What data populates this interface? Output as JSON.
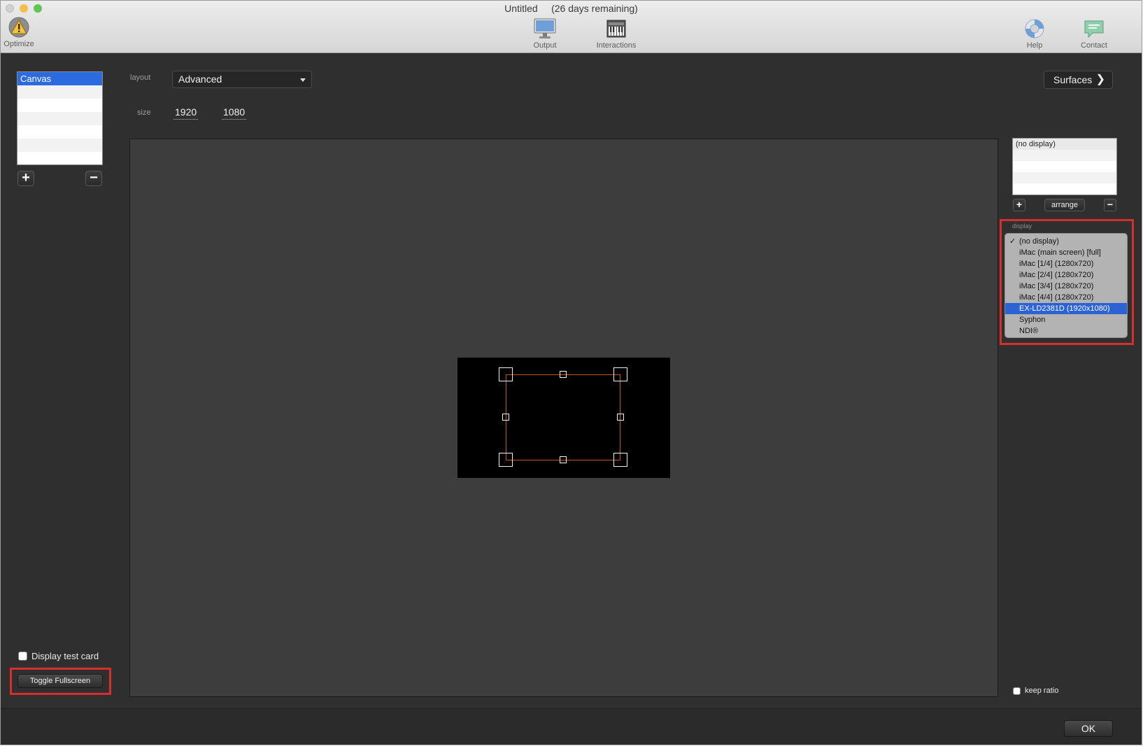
{
  "window": {
    "title": "Untitled",
    "subtitle": "(26 days remaining)"
  },
  "toolbar": {
    "optimize_label": "Optimize",
    "output_label": "Output",
    "interactions_label": "Interactions",
    "help_label": "Help",
    "contact_label": "Contact"
  },
  "canvas_list": {
    "items": [
      "Canvas"
    ]
  },
  "layout": {
    "label": "layout",
    "value": "Advanced"
  },
  "size": {
    "label": "size",
    "width": "1920",
    "height": "1080"
  },
  "surfaces_label": "Surfaces",
  "display_list": {
    "items": [
      "(no display)"
    ]
  },
  "arrange_label": "arrange",
  "display_menu": {
    "label": "display",
    "items": [
      "(no display)",
      "iMac (main screen) [full]",
      "iMac [1/4] (1280x720)",
      "iMac [2/4] (1280x720)",
      "iMac [3/4] (1280x720)",
      "iMac [4/4] (1280x720)",
      "EX-LD2381D (1920x1080)",
      "Syphon",
      "NDI®"
    ],
    "checked_index": 0,
    "highlighted_index": 6
  },
  "display_test_card_label": "Display test card",
  "toggle_fullscreen_label": "Toggle Fullscreen",
  "keep_ratio_label": "keep ratio",
  "ok_label": "OK",
  "colors": {
    "selection": "#2c6ae0",
    "highlight_box": "#d62d2d",
    "quad_border": "#c9561c"
  }
}
